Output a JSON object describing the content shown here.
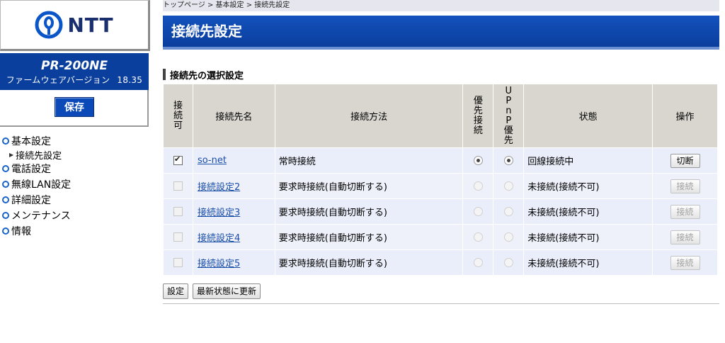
{
  "brand": {
    "logo_text": "NTT",
    "accent": "#0b3f9e"
  },
  "device": {
    "model": "PR-200NE",
    "firmware_label": "ファームウェアバージョン",
    "firmware_version": "18.35"
  },
  "sidebar": {
    "save_label": "保存",
    "items": [
      {
        "label": "基本設定",
        "sub": [
          {
            "label": "接続先設定"
          }
        ]
      },
      {
        "label": "電話設定"
      },
      {
        "label": "無線LAN設定"
      },
      {
        "label": "詳細設定"
      },
      {
        "label": "メンテナンス"
      },
      {
        "label": "情報"
      }
    ]
  },
  "breadcrumb": "トップページ > 基本設定 > 接続先設定",
  "page_title": "接続先設定",
  "section_title": "接続先の選択設定",
  "table": {
    "headers": {
      "enable": "接続可",
      "name": "接続先名",
      "method": "接続方法",
      "priority": "優先接続",
      "upnp": "UPnP優先",
      "status": "状態",
      "op": "操作"
    },
    "rows": [
      {
        "enabled": true,
        "name": "so-net",
        "method": "常時接続",
        "priority": true,
        "upnp": true,
        "status": "回線接続中",
        "op": "切断",
        "op_enabled": true
      },
      {
        "enabled": false,
        "name": "接続設定2",
        "method": "要求時接続(自動切断する)",
        "priority": false,
        "upnp": false,
        "status": "未接続(接続不可)",
        "op": "接続",
        "op_enabled": false
      },
      {
        "enabled": false,
        "name": "接続設定3",
        "method": "要求時接続(自動切断する)",
        "priority": false,
        "upnp": false,
        "status": "未接続(接続不可)",
        "op": "接続",
        "op_enabled": false
      },
      {
        "enabled": false,
        "name": "接続設定4",
        "method": "要求時接続(自動切断する)",
        "priority": false,
        "upnp": false,
        "status": "未接続(接続不可)",
        "op": "接続",
        "op_enabled": false
      },
      {
        "enabled": false,
        "name": "接続設定5",
        "method": "要求時接続(自動切断する)",
        "priority": false,
        "upnp": false,
        "status": "未接続(接続不可)",
        "op": "接続",
        "op_enabled": false
      }
    ]
  },
  "buttons": {
    "set": "設定",
    "refresh": "最新状態に更新"
  }
}
